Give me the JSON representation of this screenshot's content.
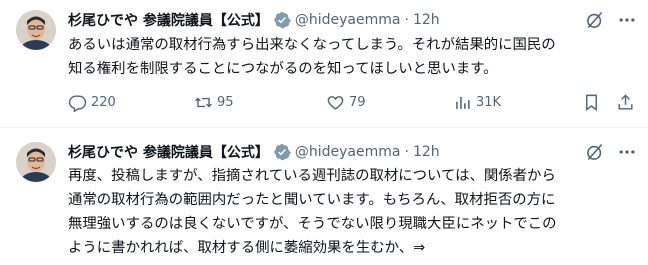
{
  "tweets": [
    {
      "name": "杉尾ひでや 参議院議員【公式】",
      "handle": "@hideyaemma",
      "separator": "·",
      "time": "12h",
      "text_lines": [
        "あるいは通常の取材行為すら出来なくなってしまう。それが結果的に国民の",
        "知る権利を制限することにつながるのを知ってほしいと思います。"
      ],
      "stats": {
        "replies": "220",
        "reposts": "95",
        "likes": "79",
        "views": "31K"
      }
    },
    {
      "name": "杉尾ひでや 参議院議員【公式】",
      "handle": "@hideyaemma",
      "separator": "·",
      "time": "12h",
      "text_lines": [
        "再度、投稿しますが、指摘されている週刊誌の取材については、関係者から",
        "通常の取材行為の範囲内だったと聞いています。もちろん、取材拒否の方に",
        "無理強いするのは良くないですが、そうでない限り現職大臣にネットでこの",
        "ように書かれれば、取材する側に萎縮効果を生むか、⇒"
      ]
    }
  ],
  "colors": {
    "text": "#0f1419",
    "secondary": "#536471",
    "verified": "#829aab",
    "divider": "#eff3f4"
  },
  "icons": [
    "verified-badge-icon",
    "grok-icon",
    "more-icon",
    "reply-icon",
    "repost-icon",
    "like-icon",
    "views-icon",
    "bookmark-icon",
    "share-icon"
  ]
}
